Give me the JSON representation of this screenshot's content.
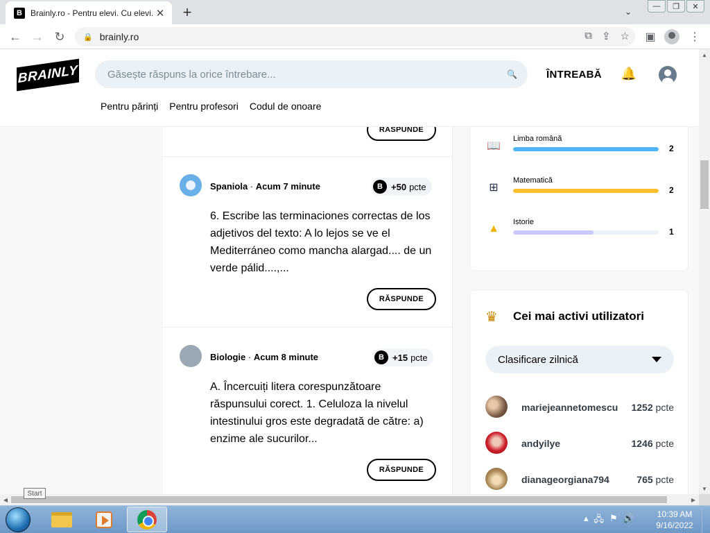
{
  "browser": {
    "tab_title": "Brainly.ro - Pentru elevi. Cu elevi.",
    "tab_favicon": "B",
    "tab_close": "✕",
    "new_tab": "+",
    "url": "brainly.ro",
    "window_buttons": [
      "—",
      "❐",
      "✕"
    ]
  },
  "site": {
    "logo": "BRAINLY",
    "search_placeholder": "Găsește răspuns la orice întrebare...",
    "ask_label": "ÎNTREABĂ",
    "subnav": [
      "Pentru părinți",
      "Pentru profesori",
      "Codul de onoare"
    ]
  },
  "feed": {
    "answer_label": "RĂSPUNDE",
    "questions": [
      {
        "subject": "Spaniola",
        "time": "Acum 7 minute",
        "points": "+50",
        "points_unit": "pcte",
        "text": "6. Escribe las terminaciones correctas de los adjetivos del texto: A lo lejos se ve el Mediterráneo como mancha alargad.... de un verde pálid....,..."
      },
      {
        "subject": "Biologie",
        "time": "Acum 8 minute",
        "points": "+15",
        "points_unit": "pcte",
        "text": "A. Încercuiți litera corespunzătoare răspunsului corect. 1. Celuloza la nivelul intestinului gros este degradată de către: a) enzime ale sucurilor..."
      }
    ]
  },
  "subjects": [
    {
      "name": "Limba română",
      "count": "2",
      "fill": 1.0,
      "color": "#4fb3f6",
      "icon": "book-icon"
    },
    {
      "name": "Matematică",
      "count": "2",
      "fill": 1.0,
      "color": "#fbbe2e",
      "icon": "grid-icon"
    },
    {
      "name": "Istorie",
      "count": "1",
      "fill": 0.55,
      "color": "#c7c9ff",
      "icon": "pyramid-icon"
    }
  ],
  "leaderboard": {
    "title": "Cei mai activi utilizatori",
    "dropdown": "Clasificare zilnică",
    "points_unit": "pcte",
    "users": [
      {
        "name": "mariejeannetomescu",
        "points": "1252"
      },
      {
        "name": "andyilye",
        "points": "1246"
      },
      {
        "name": "dianageorgiana794",
        "points": "765"
      }
    ]
  },
  "tooltip": {
    "start": "Start"
  },
  "taskbar": {
    "time": "10:39 AM",
    "date": "9/16/2022"
  }
}
